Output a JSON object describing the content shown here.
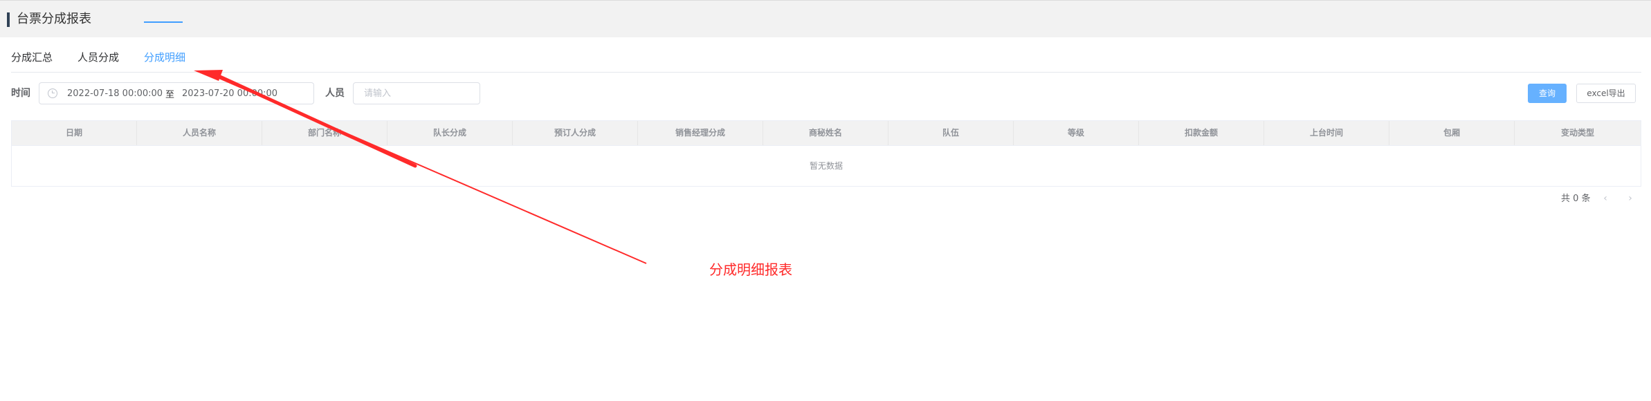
{
  "page": {
    "title": "台票分成报表"
  },
  "tabs": [
    {
      "label": "分成汇总",
      "active": false
    },
    {
      "label": "人员分成",
      "active": false
    },
    {
      "label": "分成明细",
      "active": true
    }
  ],
  "filters": {
    "time_label": "时间",
    "start_date": "2022-07-18 00:00:00",
    "range_separator": "至",
    "end_date": "2023-07-20 00:00:00",
    "person_label": "人员",
    "person_value": "",
    "person_placeholder": "请输入"
  },
  "buttons": {
    "query": "查询",
    "export": "excel导出"
  },
  "table": {
    "columns": [
      "日期",
      "人员名称",
      "部门名称",
      "队长分成",
      "预订人分成",
      "销售经理分成",
      "商秘姓名",
      "队伍",
      "等级",
      "扣款金额",
      "上台时间",
      "包厢",
      "变动类型"
    ],
    "empty_text": "暂无数据"
  },
  "pagination": {
    "total_text": "共 0 条",
    "prev_icon": "chevron-left-icon",
    "next_icon": "chevron-right-icon"
  },
  "annotation": {
    "text": "分成明细报表",
    "color": "#ff2a2a"
  },
  "colors": {
    "accent": "#409eff",
    "query_button": "#66b1ff",
    "title_accent": "#304156"
  }
}
